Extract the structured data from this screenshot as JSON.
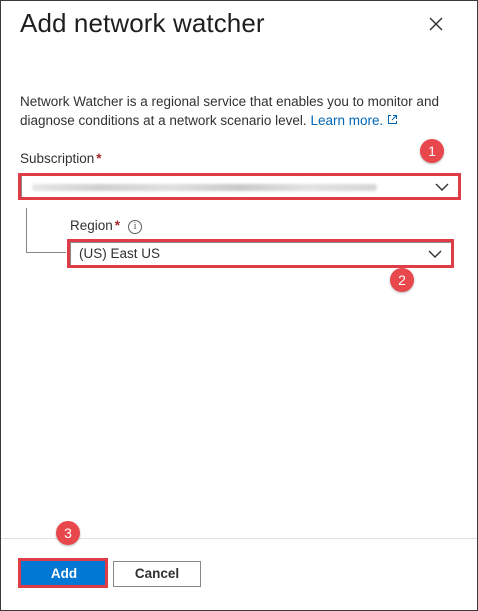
{
  "panel": {
    "title": "Add network watcher",
    "close_icon": "close-icon"
  },
  "description": {
    "text": "Network Watcher is a regional service that enables you to monitor and diagnose conditions at a network scenario level.",
    "link_label": "Learn more.",
    "link_icon": "external-link-icon"
  },
  "subscription": {
    "label": "Subscription",
    "required_marker": "*",
    "value_redacted": true
  },
  "region": {
    "label": "Region",
    "required_marker": "*",
    "info_glyph": "i",
    "value": "(US) East US"
  },
  "callouts": [
    "1",
    "2",
    "3"
  ],
  "footer": {
    "add_label": "Add",
    "cancel_label": "Cancel"
  },
  "colors": {
    "accent": "#0078d4",
    "highlight": "#e03c48",
    "badge": "#e8474b",
    "link": "#0067b8",
    "required": "#a4262c"
  }
}
